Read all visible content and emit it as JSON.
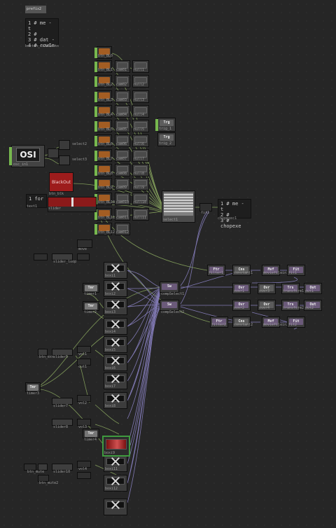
{
  "network": {
    "code_top": {
      "label": "prefix2",
      "lines": [
        "1  # me - t",
        "2  #",
        "3  # dat -",
        "4  # rowIn"
      ],
      "footer": "button_callbacks"
    },
    "code_mid": {
      "lines": [
        "1  # me - t",
        "2  #",
        "3  # chopexe"
      ],
      "footer": "chopexec1"
    },
    "code_left": {
      "lines": [
        "1  for"
      ],
      "footer": "text1"
    },
    "osi": {
      "title": "OSI",
      "label": "osc_in1"
    },
    "blackout": {
      "title": "BlackOut",
      "label": "btn_blk"
    },
    "slider_main": {
      "label": "slider"
    },
    "select": {
      "label": "select1"
    },
    "fit_main": {
      "label": "fit1"
    },
    "triggers": [
      {
        "icon": "Trg",
        "label": "trig_1"
      },
      {
        "icon": "Trg",
        "label": "trig_2"
      }
    ],
    "button_chops": [
      {
        "label": "btn_BL0",
        "op": "",
        "out": ""
      },
      {
        "label": "btn_BL1",
        "op": "cam01",
        "out": "null1"
      },
      {
        "label": "btn_BL2",
        "op": "cam02",
        "out": "null2"
      },
      {
        "label": "btn_BL3",
        "op": "cam03",
        "out": "null3"
      },
      {
        "label": "btn_BL4",
        "op": "cam04",
        "out": "null4"
      },
      {
        "label": "btn_BL5",
        "op": "cam05",
        "out": "null5"
      },
      {
        "label": "btn_BL6",
        "op": "cam06",
        "out": "null6"
      },
      {
        "label": "btn_BL7",
        "op": "cam07",
        "out": "null7"
      },
      {
        "label": "btn_BL8",
        "op": "cam08",
        "out": "null8"
      },
      {
        "label": "btn_BL9",
        "op": "cam09",
        "out": "null9"
      },
      {
        "label": "btn_BL10",
        "op": "cam010",
        "out": "null10"
      },
      {
        "label": "btn_BL11",
        "op": "cam011",
        "out": "null11"
      },
      {
        "label": "btn_BL12",
        "op": "cam012",
        "out": ""
      }
    ],
    "tops": [
      {
        "label": "boxi1"
      },
      {
        "label": "boxi2"
      },
      {
        "label": "boxi3"
      },
      {
        "label": "boxi4"
      },
      {
        "label": "boxi5"
      },
      {
        "label": "boxi6"
      },
      {
        "label": "boxi7"
      },
      {
        "label": "boxi8"
      },
      {
        "label": "boxi9"
      },
      {
        "label": "boxi10"
      },
      {
        "label": "boxi11"
      },
      {
        "label": "boxi12"
      }
    ],
    "switches": [
      {
        "icon": "Sw",
        "label": "compSelect1"
      },
      {
        "icon": "Sw",
        "label": "compSelect2"
      }
    ],
    "pipeline_top": [
      {
        "icon": "Ftr",
        "label": "filter1"
      },
      {
        "icon": "Cns",
        "label": "constant1"
      },
      {
        "icon": "Mvf",
        "label": "moviefilein1"
      },
      {
        "icon": "Fit",
        "label": "fit1"
      }
    ],
    "pipeline_mid": [
      {
        "icon": "Ovr",
        "label": "over1"
      },
      {
        "icon": "Ovr",
        "label": "over3"
      },
      {
        "icon": "Trs",
        "label": "transform1"
      },
      {
        "icon": "Out",
        "label": "out1"
      }
    ],
    "pipeline_mid2": [
      {
        "icon": "Ovr",
        "label": "over2"
      },
      {
        "icon": "Ovr",
        "label": "over4"
      },
      {
        "icon": "Trs",
        "label": "transform2"
      },
      {
        "icon": "Out",
        "label": "out2"
      }
    ],
    "pipeline_bot": [
      {
        "icon": "Ftr",
        "label": "filter2"
      },
      {
        "icon": "Cns",
        "label": "constant2"
      },
      {
        "icon": "Mvf",
        "label": "moviefilein2"
      },
      {
        "icon": "Fit",
        "label": "fit2"
      }
    ],
    "timers": [
      {
        "icon": "Tmr",
        "label": "timer1"
      },
      {
        "icon": "Tmr",
        "label": "timer2"
      },
      {
        "icon": "Tmr",
        "label": "timer3"
      },
      {
        "icon": "Tmr",
        "label": "timer4"
      }
    ],
    "misc_labels": {
      "null_a": "null1",
      "null_b": "null2",
      "row_left": "slider_loop",
      "row_left2": "slider5",
      "row_left3": "slider7",
      "row_left4": "slider8",
      "row_left5": "slider10",
      "vol1": "vol1",
      "vol2": "vol2",
      "vol3": "vol3",
      "vol4": "vol4",
      "cut1": "cut1",
      "boxi_note": "move",
      "btn_a": "btn_ext",
      "btn_b": "btn_mute",
      "btn_c": "btn_mute2",
      "sel_a": "select2",
      "sel_b": "select3",
      "res1": "sub0",
      "res2": "sub1"
    }
  }
}
